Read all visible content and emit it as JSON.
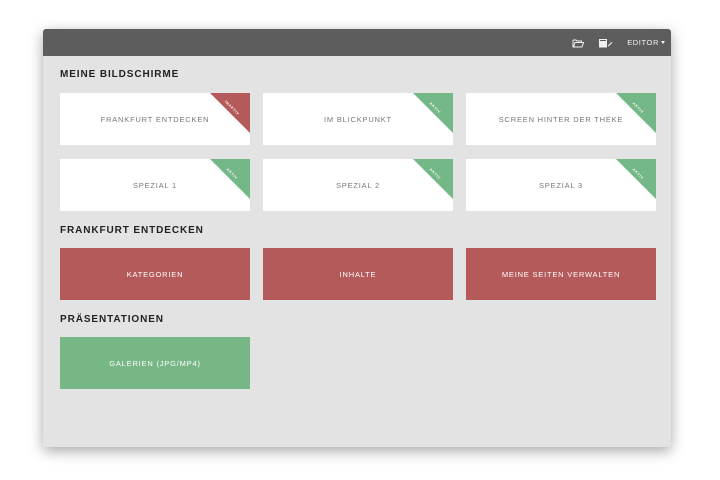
{
  "colors": {
    "window_bg": "#e3e3e3",
    "topbar": "#5d5d5d",
    "inactive": "#b55a5a",
    "active": "#75b887",
    "tile_red": "#b55a5a",
    "tile_green": "#77b786"
  },
  "topbar": {
    "icons": [
      "folder-open-icon",
      "book-edit-icon"
    ],
    "editor_label": "EDITOR"
  },
  "sections": {
    "screens": {
      "title": "MEINE BILDSCHIRME"
    },
    "frankfurt": {
      "title": "FRANKFURT ENTDECKEN"
    },
    "presentations": {
      "title": "PRÄSENTATIONEN"
    }
  },
  "screens": [
    {
      "label": "FRANKFURT ENTDECKEN",
      "status": "INAKTIV",
      "color": "#b55a5a"
    },
    {
      "label": "IM BLICKPUNKT",
      "status": "AKTIV",
      "color": "#75b887"
    },
    {
      "label": "SCREEN HINTER DER THEKE",
      "status": "AKTIV",
      "color": "#75b887"
    },
    {
      "label": "SPEZIAL 1",
      "status": "AKTIV",
      "color": "#75b887"
    },
    {
      "label": "SPEZIAL 2",
      "status": "AKTIV",
      "color": "#75b887"
    },
    {
      "label": "SPEZIAL 3",
      "status": "AKTIV",
      "color": "#75b887"
    }
  ],
  "frankfurt_tiles": [
    {
      "label": "KATEGORIEN"
    },
    {
      "label": "INHALTE"
    },
    {
      "label": "MEINE SEITEN VERWALTEN"
    }
  ],
  "presentation_tiles": [
    {
      "label": "GALERIEN (JPG/MP4)"
    }
  ]
}
